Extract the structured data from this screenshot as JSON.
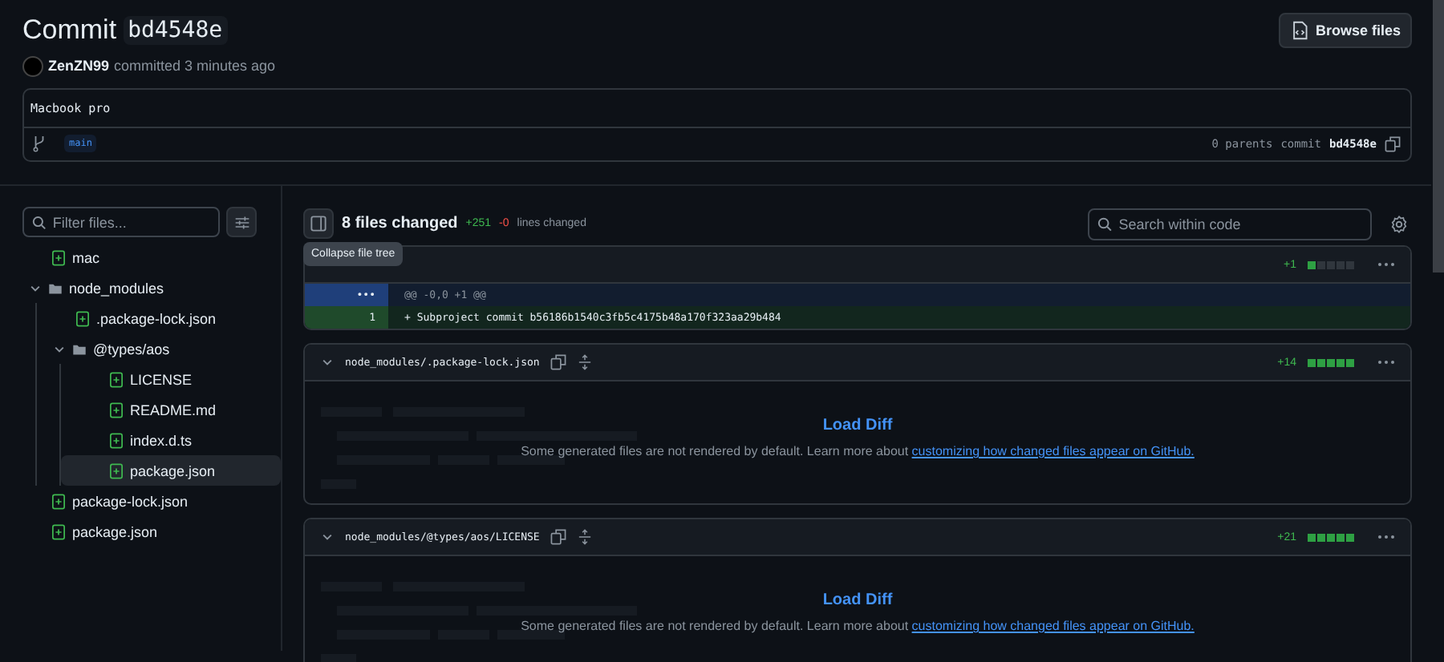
{
  "header": {
    "title": "Commit",
    "sha": "bd4548e",
    "author": "ZenZN99",
    "action": "committed 3 minutes ago",
    "browse_button": "Browse files"
  },
  "commit_box": {
    "message": "Macbook pro",
    "branch": "main",
    "parents": "0 parents",
    "commit_label": "commit",
    "commit_sha": "bd4548e"
  },
  "sidebar": {
    "filter": {
      "placeholder": "Filter files..."
    },
    "tree": [
      {
        "kind": "file",
        "name": "mac",
        "selected": false
      },
      {
        "kind": "folder",
        "name": "node_modules",
        "expanded": true,
        "children": [
          {
            "kind": "file",
            "name": ".package-lock.json",
            "selected": false
          },
          {
            "kind": "folder",
            "name": "@types/aos",
            "expanded": true,
            "children": [
              {
                "kind": "file",
                "name": "LICENSE",
                "selected": false
              },
              {
                "kind": "file",
                "name": "README.md",
                "selected": false
              },
              {
                "kind": "file",
                "name": "index.d.ts",
                "selected": false
              },
              {
                "kind": "file",
                "name": "package.json",
                "selected": true
              }
            ]
          }
        ]
      },
      {
        "kind": "file",
        "name": "package-lock.json",
        "selected": false
      },
      {
        "kind": "file",
        "name": "package.json",
        "selected": false
      }
    ]
  },
  "toolbar": {
    "files_changed": "8 files changed",
    "additions": "+251",
    "deletions": "-0",
    "lines_label": "lines changed",
    "search": {
      "placeholder": "Search within code"
    },
    "tooltip": "Collapse file tree"
  },
  "files": [
    {
      "kind": "diff",
      "additions": "+1",
      "level": 0.2,
      "lines": [
        {
          "kind": "hunk",
          "number": "•••",
          "text": "@@ -0,0 +1 @@"
        },
        {
          "kind": "add",
          "number": "1",
          "text": "+ Subproject commit b56186b1540c3fb5c4175b48a170f323aa29b484"
        }
      ]
    },
    {
      "kind": "generated",
      "path": "node_modules/.package-lock.json",
      "additions": "+14",
      "level": 1,
      "load": "Load Diff",
      "note": "Some generated files are not rendered by default. Learn more about",
      "link": "customizing how changed files appear on GitHub."
    },
    {
      "kind": "generated",
      "path": "node_modules/@types/aos/LICENSE",
      "additions": "+21",
      "level": 1,
      "load": "Load Diff",
      "note": "Some generated files are not rendered by default. Learn more about",
      "link": "customizing how changed files appear on GitHub."
    }
  ]
}
